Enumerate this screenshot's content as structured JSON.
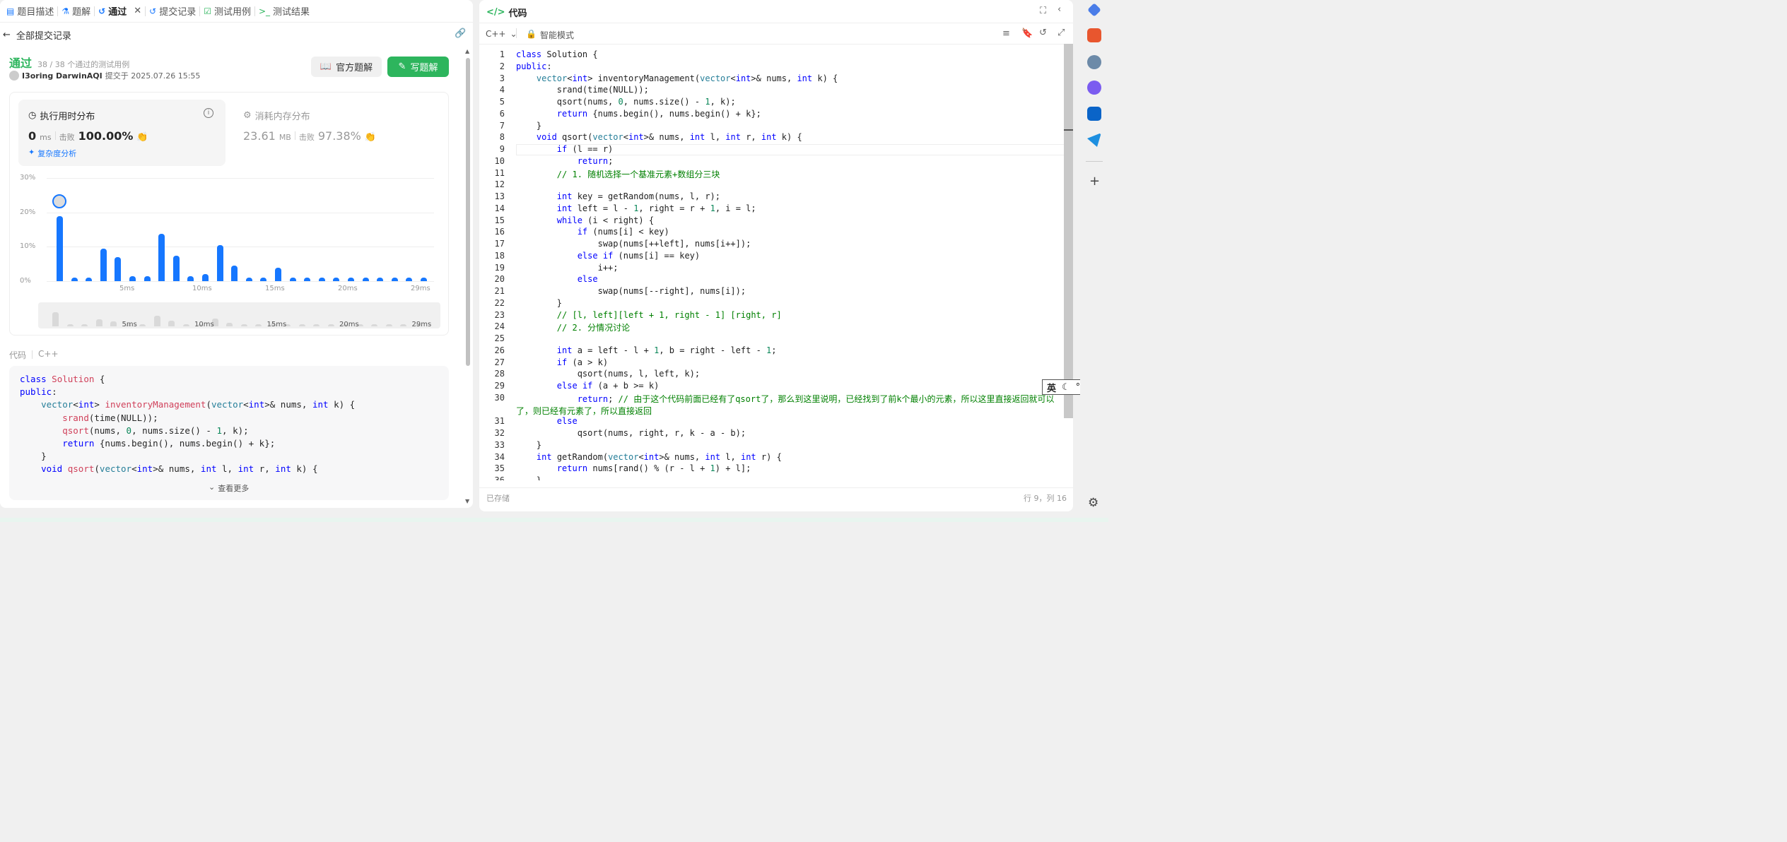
{
  "tabs": [
    {
      "label": "题目描述",
      "icon": "document-icon"
    },
    {
      "label": "题解",
      "icon": "flask-icon"
    },
    {
      "label": "通过",
      "icon": "history-icon",
      "active": true
    },
    {
      "label": "提交记录",
      "icon": "history-icon"
    },
    {
      "label": "测试用例",
      "icon": "checkbox-icon"
    },
    {
      "label": "测试结果",
      "icon": "terminal-icon"
    }
  ],
  "left": {
    "back_label": "全部提交记录",
    "status": "通过",
    "passed_cases": "38 / 38 个通过的测试用例",
    "author": "I3oring DarwinAQI",
    "submitted_at": "提交于 2025.07.26 15:55",
    "btn_official": "官方题解",
    "btn_write": "写题解",
    "runtime": {
      "title": "执行用时分布",
      "value": "0",
      "unit": "ms",
      "beats_label": "击败",
      "beats": "100.00%",
      "complexity": "复杂度分析"
    },
    "memory": {
      "title": "消耗内存分布",
      "value": "23.61",
      "unit": "MB",
      "beats_label": "击败",
      "beats": "97.38%"
    },
    "code_label": "代码",
    "code_lang": "C++",
    "see_more": "查看更多",
    "preview": [
      "class Solution {",
      "public:",
      "    vector<int> inventoryManagement(vector<int>& nums, int k) {",
      "        srand(time(NULL));",
      "        qsort(nums, 0, nums.size() - 1, k);",
      "        return {nums.begin(), nums.begin() + k};",
      "    }",
      "    void qsort(vector<int>& nums, int l, int r, int k) {"
    ]
  },
  "chart_data": {
    "type": "bar",
    "title": "执行用时分布",
    "ylabel": "",
    "xlabel": "",
    "yticks": [
      "30%",
      "20%",
      "10%",
      "0%"
    ],
    "ylim": [
      0,
      30
    ],
    "xticks": [
      "5ms",
      "10ms",
      "15ms",
      "20ms",
      "29ms"
    ],
    "values": [
      19,
      1,
      1,
      9.5,
      7,
      1.5,
      1.5,
      13.7,
      7.3,
      1.5,
      2,
      10.5,
      4.5,
      1,
      1,
      4,
      1,
      1,
      1,
      1,
      1,
      1,
      1,
      1,
      1,
      1
    ],
    "highlight_index": 0,
    "bar_color": "#1677ff"
  },
  "right": {
    "title": "代码",
    "lang": "C++",
    "mode": "智能模式",
    "saved": "已存储",
    "cursor": "行 9，列 16",
    "code": [
      {
        "n": "1",
        "t": "class Solution {"
      },
      {
        "n": "2",
        "t": "public:"
      },
      {
        "n": "3",
        "t": "    vector<int> inventoryManagement(vector<int>& nums, int k) {"
      },
      {
        "n": "4",
        "t": "        srand(time(NULL));"
      },
      {
        "n": "5",
        "t": "        qsort(nums, 0, nums.size() - 1, k);"
      },
      {
        "n": "6",
        "t": "        return {nums.begin(), nums.begin() + k};"
      },
      {
        "n": "7",
        "t": "    }"
      },
      {
        "n": "8",
        "t": "    void qsort(vector<int>& nums, int l, int r, int k) {"
      },
      {
        "n": "9",
        "t": "        if (l == r)"
      },
      {
        "n": "10",
        "t": "            return;"
      },
      {
        "n": "11",
        "t": "        // 1. 随机选择一个基准元素+数组分三块"
      },
      {
        "n": "12",
        "t": ""
      },
      {
        "n": "13",
        "t": "        int key = getRandom(nums, l, r);"
      },
      {
        "n": "14",
        "t": "        int left = l - 1, right = r + 1, i = l;"
      },
      {
        "n": "15",
        "t": "        while (i < right) {"
      },
      {
        "n": "16",
        "t": "            if (nums[i] < key)"
      },
      {
        "n": "17",
        "t": "                swap(nums[++left], nums[i++]);"
      },
      {
        "n": "18",
        "t": "            else if (nums[i] == key)"
      },
      {
        "n": "19",
        "t": "                i++;"
      },
      {
        "n": "20",
        "t": "            else"
      },
      {
        "n": "21",
        "t": "                swap(nums[--right], nums[i]);"
      },
      {
        "n": "22",
        "t": "        }"
      },
      {
        "n": "23",
        "t": "        // [l, left][left + 1, right - 1] [right, r]"
      },
      {
        "n": "24",
        "t": "        // 2. 分情况讨论"
      },
      {
        "n": "25",
        "t": ""
      },
      {
        "n": "26",
        "t": "        int a = left - l + 1, b = right - left - 1;"
      },
      {
        "n": "27",
        "t": "        if (a > k)"
      },
      {
        "n": "28",
        "t": "            qsort(nums, l, left, k);"
      },
      {
        "n": "29",
        "t": "        else if (a + b >= k)"
      },
      {
        "n": "30",
        "t": "            return; // 由于这个代码前面已经有了qsort了，那么到这里说明，已经找到了前k个最小的元素，所以这里直接返回就可以"
      },
      {
        "n": "",
        "t": "了，则已经有元素了，所以直接返回"
      },
      {
        "n": "31",
        "t": "        else"
      },
      {
        "n": "32",
        "t": "            qsort(nums, right, r, k - a - b);"
      },
      {
        "n": "33",
        "t": "    }"
      },
      {
        "n": "34",
        "t": "    int getRandom(vector<int>& nums, int l, int r) {"
      },
      {
        "n": "35",
        "t": "        return nums[rand() % (r - l + 1) + l];"
      },
      {
        "n": "36",
        "t": "    }"
      }
    ]
  },
  "ime": {
    "label": "英"
  }
}
